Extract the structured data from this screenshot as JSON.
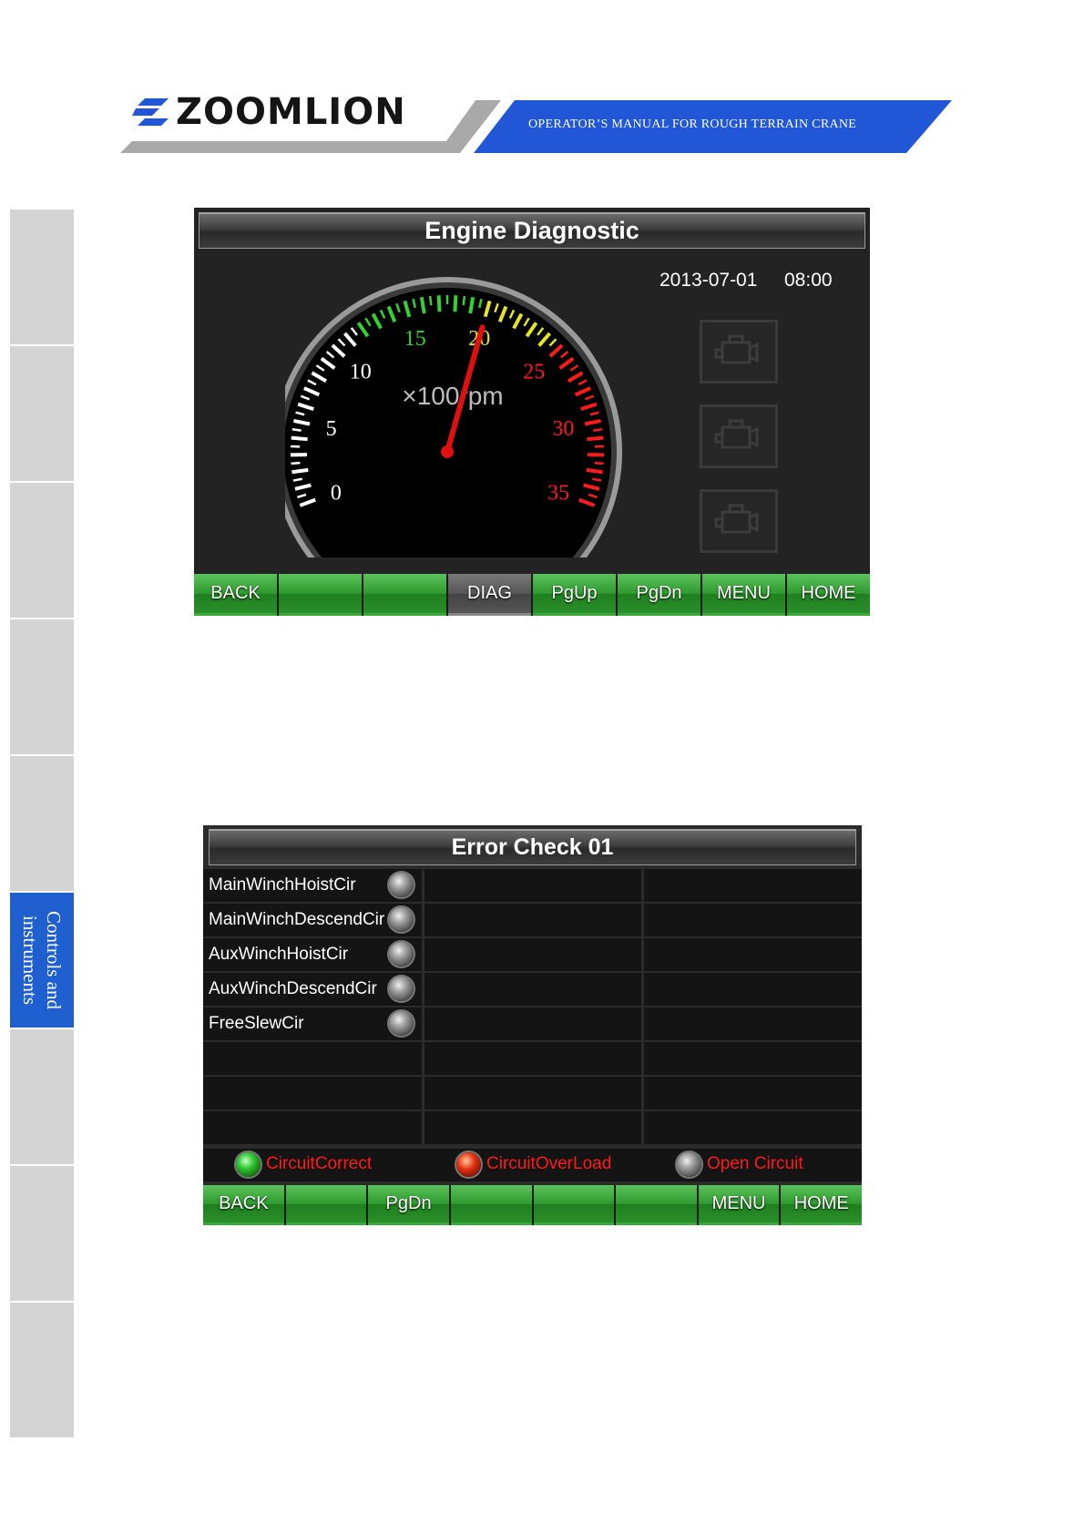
{
  "header": {
    "brand": "ZOOMLION",
    "manual_title": "OPERATOR’S MANUAL FOR ROUGH TERRAIN CRANE"
  },
  "side_tabs": {
    "active_label_line1": "Controls and",
    "active_label_line2": "instruments"
  },
  "engine_panel": {
    "title": "Engine Diagnostic",
    "date": "2013-07-01",
    "time": "08:00",
    "gauge": {
      "unit_label": "×100rpm",
      "min": 0,
      "max": 35,
      "value": 20,
      "tick_labels": [
        "0",
        "5",
        "10",
        "15",
        "20",
        "25",
        "30",
        "35"
      ],
      "colors": {
        "low": "#ffffff",
        "green": "#2fd52f",
        "yellow": "#e6e61e",
        "red": "#ff1a1a",
        "needle": "#e01010"
      }
    },
    "warning_icons": [
      "engine-icon",
      "engine-icon",
      "engine-icon"
    ],
    "buttons": [
      "BACK",
      "",
      "",
      "DIAG",
      "PgUp",
      "PgDn",
      "MENU",
      "HOME"
    ]
  },
  "error_panel": {
    "title": "Error Check 01",
    "rows": [
      {
        "label": "MainWinchHoistCir",
        "status": "gray"
      },
      {
        "label": "MainWinchDescendCir",
        "status": "gray"
      },
      {
        "label": "AuxWinchHoistCir",
        "status": "gray"
      },
      {
        "label": "AuxWinchDescendCir",
        "status": "gray"
      },
      {
        "label": "FreeSlewCir",
        "status": "gray"
      },
      {
        "label": "",
        "status": "none"
      },
      {
        "label": "",
        "status": "none"
      },
      {
        "label": "",
        "status": "none"
      }
    ],
    "legend": [
      {
        "label": "CircuitCorrect",
        "color": "green"
      },
      {
        "label": "CircuitOverLoad",
        "color": "red"
      },
      {
        "label": "Open Circuit",
        "color": "gray"
      }
    ],
    "buttons": [
      "BACK",
      "",
      "PgDn",
      "",
      "",
      "",
      "MENU",
      "HOME"
    ]
  }
}
